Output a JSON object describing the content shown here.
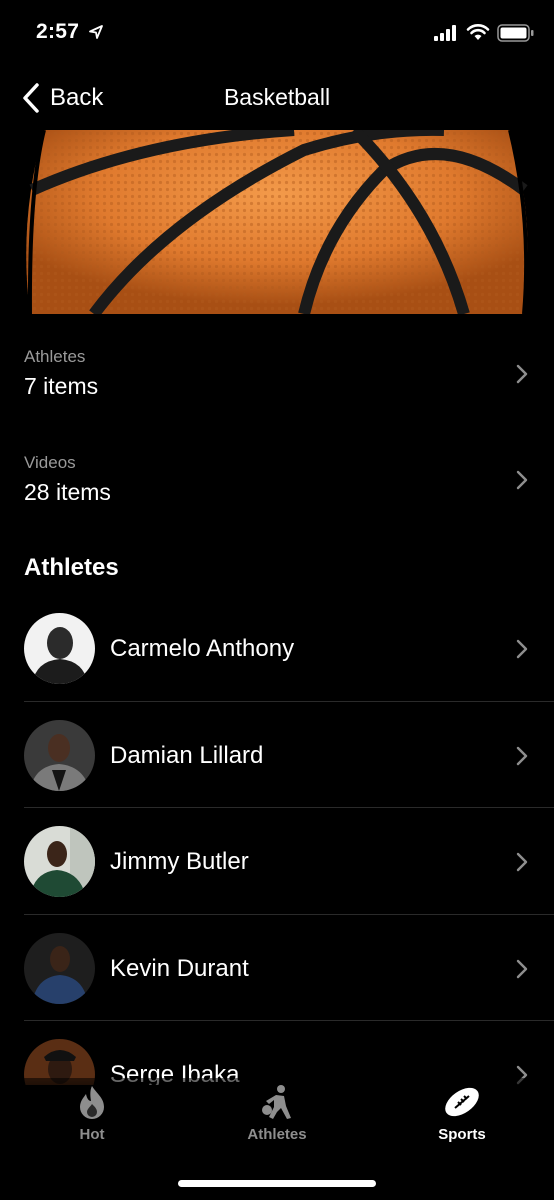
{
  "status_bar": {
    "time": "2:57"
  },
  "nav": {
    "back_label": "Back",
    "title": "Basketball"
  },
  "hero": {
    "icon": "basketball-image"
  },
  "summary": [
    {
      "label": "Athletes",
      "value": "7 items"
    },
    {
      "label": "Videos",
      "value": "28 items"
    }
  ],
  "section_title": "Athletes",
  "athletes": [
    {
      "name": "Carmelo Anthony"
    },
    {
      "name": "Damian Lillard"
    },
    {
      "name": "Jimmy Butler"
    },
    {
      "name": "Kevin Durant"
    },
    {
      "name": "Serge Ibaka"
    }
  ],
  "tabs": [
    {
      "label": "Hot",
      "icon": "flame-icon",
      "active": false
    },
    {
      "label": "Athletes",
      "icon": "athlete-icon",
      "active": false
    },
    {
      "label": "Sports",
      "icon": "football-icon",
      "active": true
    }
  ],
  "colors": {
    "background": "#000000",
    "secondary_text": "#9a9a9a",
    "ball_orange": "#e07a2e"
  }
}
